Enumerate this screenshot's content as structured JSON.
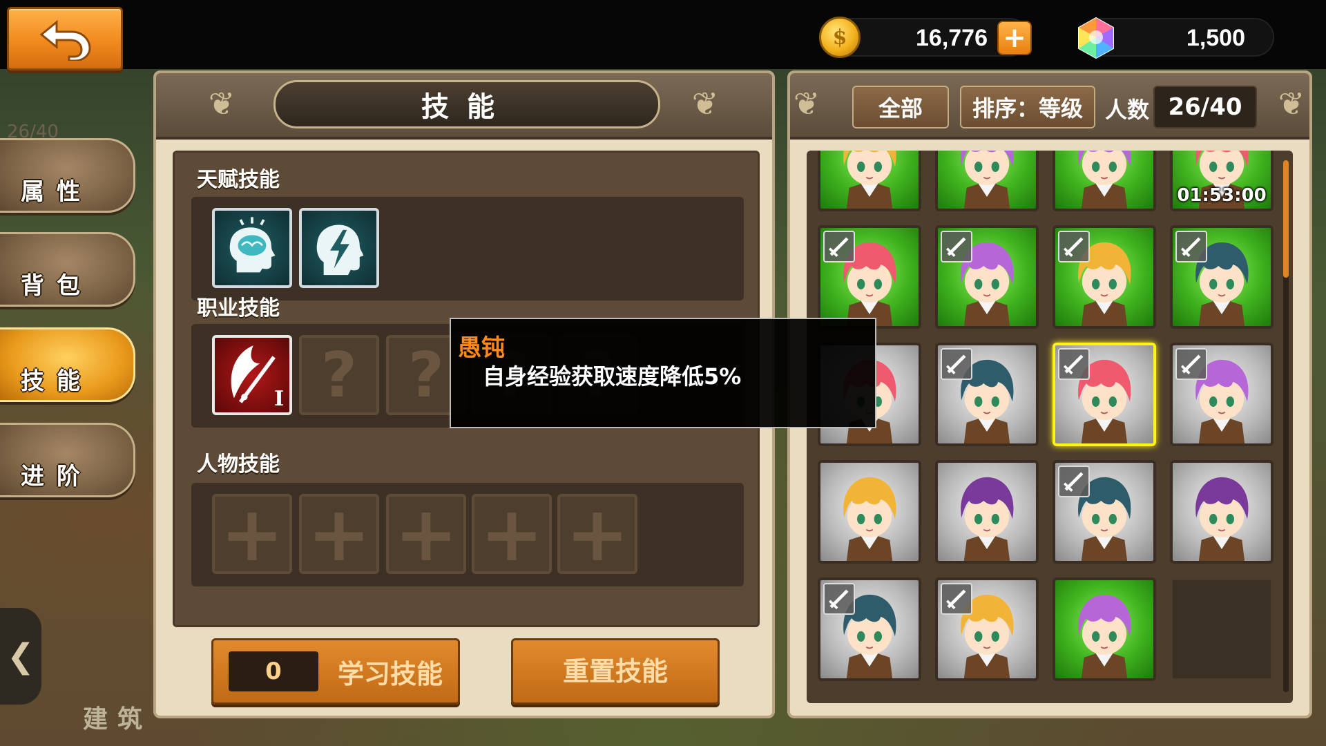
{
  "header": {
    "gold_value": "16,776",
    "gem_value": "1,500",
    "plus_label": "+"
  },
  "sidebar": {
    "counter": "26/40",
    "tabs": [
      {
        "label": "属性"
      },
      {
        "label": "背包"
      },
      {
        "label": "技能"
      },
      {
        "label": "进阶"
      }
    ],
    "active_index": 2,
    "arrow": "❮",
    "building_label": "建筑"
  },
  "skill_panel": {
    "title": "技能",
    "sections": {
      "talent": "天赋技能",
      "job": "职业技能",
      "character": "人物技能"
    },
    "job_skill_level": "I",
    "learn_count": "0",
    "learn_label": "学习技能",
    "reset_label": "重置技能"
  },
  "tooltip": {
    "title": "愚钝",
    "description": "自身经验获取速度降低5%"
  },
  "hero_panel": {
    "filter_all": "全部",
    "sort_label": "排序：等级",
    "count_label": "人数",
    "count_value": "26/40",
    "scroll_fraction": 0.22,
    "heroes": [
      {
        "bg": "green",
        "hair": "#f2b436",
        "locked": true,
        "timer": ""
      },
      {
        "bg": "green",
        "hair": "#b766d8",
        "locked": true,
        "timer": ""
      },
      {
        "bg": "green",
        "hair": "#b766d8",
        "locked": true,
        "timer": ""
      },
      {
        "bg": "green",
        "hair": "#ef5a6e",
        "locked": false,
        "timer": "01:53:00"
      },
      {
        "bg": "green",
        "hair": "#ef5a6e",
        "locked": true,
        "timer": ""
      },
      {
        "bg": "green",
        "hair": "#b766d8",
        "locked": true,
        "timer": ""
      },
      {
        "bg": "green",
        "hair": "#f2b436",
        "locked": true,
        "timer": ""
      },
      {
        "bg": "green",
        "hair": "#2f5c6a",
        "locked": true,
        "timer": ""
      },
      {
        "bg": "grey",
        "hair": "#ef5a6e",
        "locked": false,
        "timer": ""
      },
      {
        "bg": "grey",
        "hair": "#2f5c6a",
        "locked": true,
        "timer": ""
      },
      {
        "bg": "grey",
        "hair": "#ef5a6e",
        "locked": true,
        "timer": "",
        "selected": true
      },
      {
        "bg": "grey",
        "hair": "#b766d8",
        "locked": true,
        "timer": ""
      },
      {
        "bg": "grey",
        "hair": "#f2b436",
        "locked": false,
        "timer": ""
      },
      {
        "bg": "grey",
        "hair": "#7a3a9a",
        "locked": false,
        "timer": ""
      },
      {
        "bg": "grey",
        "hair": "#2f5c6a",
        "locked": true,
        "timer": ""
      },
      {
        "bg": "grey",
        "hair": "#7a3a9a",
        "locked": false,
        "timer": ""
      },
      {
        "bg": "grey",
        "hair": "#2f5c6a",
        "locked": true,
        "timer": ""
      },
      {
        "bg": "grey",
        "hair": "#f2b436",
        "locked": true,
        "timer": ""
      },
      {
        "bg": "green",
        "hair": "#b766d8",
        "locked": false,
        "timer": ""
      },
      {
        "bg": "empty",
        "hair": "",
        "locked": false,
        "timer": ""
      }
    ]
  },
  "colors": {
    "accent_orange": "#f08a1e",
    "tooltip_title": "#ff8a1a",
    "selected_border": "#fff31a"
  }
}
